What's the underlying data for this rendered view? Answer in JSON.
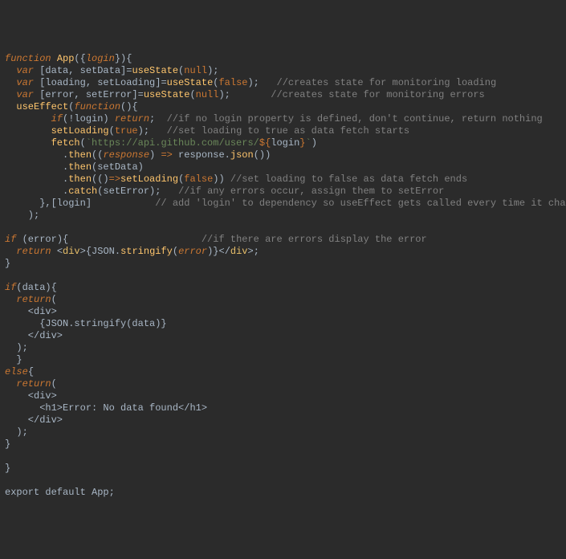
{
  "lines": {
    "l1": {
      "a": "function",
      "b": " ",
      "c": "App",
      "d": "({",
      "e": "login",
      "f": "}){"
    },
    "l2": {
      "a": "  ",
      "b": "var",
      "c": " [data, setData]",
      "d": "=",
      "e": "useState",
      "f": "(",
      "g": "null",
      "h": ");"
    },
    "l3": {
      "a": "  ",
      "b": "var",
      "c": " [loading, setLoading]",
      "d": "=",
      "e": "useState",
      "f": "(",
      "g": "false",
      "h": ");   ",
      "i": "//creates state for monitoring loading"
    },
    "l4": {
      "a": "  ",
      "b": "var",
      "c": " [error, setError]",
      "d": "=",
      "e": "useState",
      "f": "(",
      "g": "null",
      "h": ");       ",
      "i": "//creates state for monitoring errors"
    },
    "l5": {
      "a": "  ",
      "b": "useEffect",
      "c": "(",
      "d": "function",
      "e": "(){"
    },
    "l6": {
      "a": "        ",
      "b": "if",
      "c": "(!login) ",
      "d": "return",
      "e": ";  ",
      "f": "//if no login property is defined, don't continue, return nothing"
    },
    "l7": {
      "a": "        ",
      "b": "setLoading",
      "c": "(",
      "d": "true",
      "e": ");   ",
      "f": "//set loading to true as data fetch starts"
    },
    "l8": {
      "a": "        ",
      "b": "fetch",
      "c": "(",
      "d": "`https://api.github.com/users/",
      "e": "${",
      "f": "login",
      "g": "}",
      "h": "`",
      "i": ")"
    },
    "l9": {
      "a": "          .",
      "b": "then",
      "c": "((",
      "d": "response",
      "e": ") ",
      "f": "=>",
      "g": " response.",
      "h": "json",
      "i": "())"
    },
    "l10": {
      "a": "          .",
      "b": "then",
      "c": "(setData)"
    },
    "l11": {
      "a": "          .",
      "b": "then",
      "c": "(()",
      "d": "=>",
      "e": "setLoading",
      "f": "(",
      "g": "false",
      "h": ")) ",
      "i": "//set loading to false as data fetch ends"
    },
    "l12": {
      "a": "          .",
      "b": "catch",
      "c": "(setError);   ",
      "d": "//if any errors occur, assign them to setError"
    },
    "l13": {
      "a": "      },[login]           ",
      "b": "// add 'login' to dependency so useEffect gets called every time it changes"
    },
    "l14": {
      "a": "    );"
    },
    "l15": {
      "a": ""
    },
    "l16": {
      "a": "if ",
      "b": "(error){                       ",
      "c": "//if there are errors display the error"
    },
    "l17": {
      "a": "  ",
      "b": "return ",
      "c": "<",
      "d": "div",
      "e": ">{JSON.",
      "f": "stringify",
      "g": "(",
      "h": "error",
      "i": ")}",
      "j": "</",
      "k": "div",
      "l": ">;"
    },
    "l18": {
      "a": "}"
    },
    "l19": {
      "a": ""
    },
    "l20": {
      "a": "if",
      "b": "(data){"
    },
    "l21": {
      "a": "  ",
      "b": "return",
      "c": "("
    },
    "l22": {
      "a": "    <div>"
    },
    "l23": {
      "a": "      {JSON.stringify(data)}"
    },
    "l24": {
      "a": "    </div>"
    },
    "l25": {
      "a": "  );"
    },
    "l26": {
      "a": "  }"
    },
    "l27": {
      "a": "else",
      "b": "{"
    },
    "l28": {
      "a": "  ",
      "b": "return",
      "c": "("
    },
    "l29": {
      "a": "    <div>"
    },
    "l30": {
      "a": "      <h1>Error: No data found</h1>"
    },
    "l31": {
      "a": "    </div>"
    },
    "l32": {
      "a": "  );"
    },
    "l33": {
      "a": "}"
    },
    "l34": {
      "a": ""
    },
    "l35": {
      "a": "}"
    },
    "l36": {
      "a": ""
    },
    "l37": {
      "a": "export default App;"
    }
  }
}
